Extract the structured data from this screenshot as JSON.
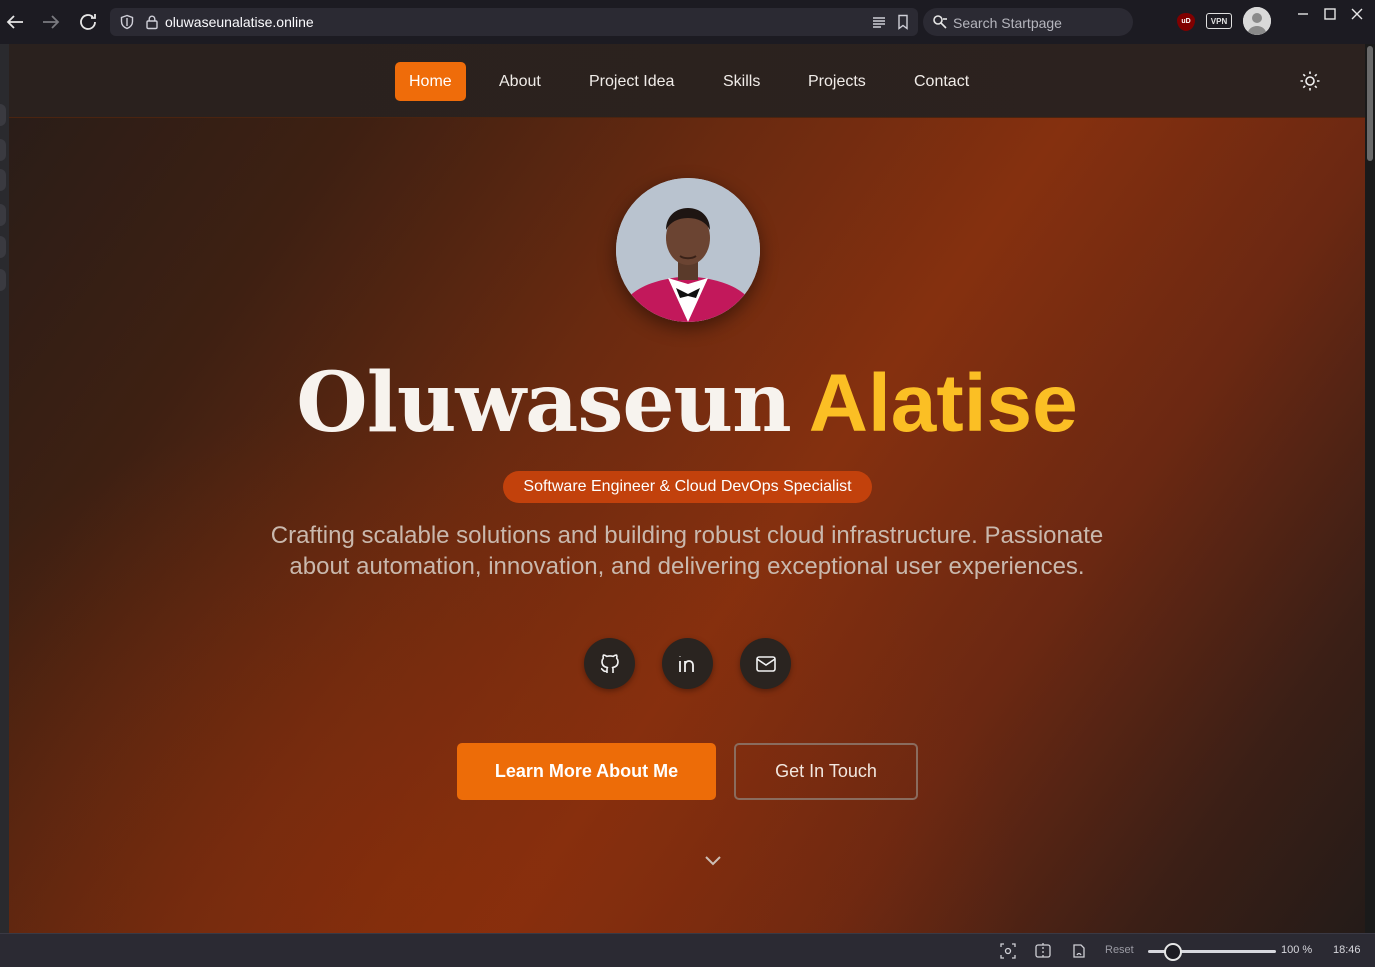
{
  "browser": {
    "url": "oluwaseunalatise.online",
    "search_placeholder": "Search Startpage",
    "extensions": {
      "ublock_label": "uD",
      "vpn_label": "VPN"
    }
  },
  "nav": {
    "items": [
      {
        "label": "Home",
        "active": true
      },
      {
        "label": "About",
        "active": false
      },
      {
        "label": "Project Idea",
        "active": false
      },
      {
        "label": "Skills",
        "active": false
      },
      {
        "label": "Projects",
        "active": false
      },
      {
        "label": "Contact",
        "active": false
      }
    ],
    "theme_toggle_icon": "sun-icon"
  },
  "hero": {
    "first_name": "Oluwaseun",
    "last_name": "Alatise",
    "role": "Software Engineer & Cloud DevOps Specialist",
    "tagline": "Crafting scalable solutions and building robust cloud infrastructure. Passionate about automation, innovation, and delivering exceptional user experiences.",
    "social_icons": [
      "github-icon",
      "linkedin-icon",
      "mail-icon"
    ],
    "primary_cta": "Learn More About Me",
    "secondary_cta": "Get In Touch",
    "scroll_icon": "chevron-down-icon"
  },
  "colors": {
    "accent": "#ef6c0a",
    "name_highlight": "#fbbf24",
    "badge": "#c2410c"
  },
  "statusbar": {
    "reset_label": "Reset",
    "zoom": "100 %",
    "clock": "18:46"
  }
}
